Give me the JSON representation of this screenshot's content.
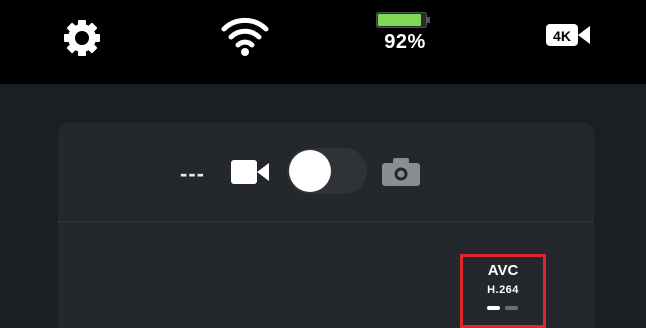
{
  "status_bar": {
    "settings_icon": "gear-icon",
    "wifi_icon": "wifi-icon",
    "battery": {
      "percent_text": "92%",
      "level": 0.92,
      "color": "#7ed957"
    },
    "resolution_badge": "4K"
  },
  "capture": {
    "counter": "---",
    "video_icon": "video-camera-icon",
    "photo_icon": "photo-camera-icon",
    "mode_toggle": "video"
  },
  "codec": {
    "name": "AVC",
    "sub": "H.264",
    "page_indicator": {
      "count": 2,
      "active": 1
    },
    "highlight_color": "#e0262c"
  }
}
